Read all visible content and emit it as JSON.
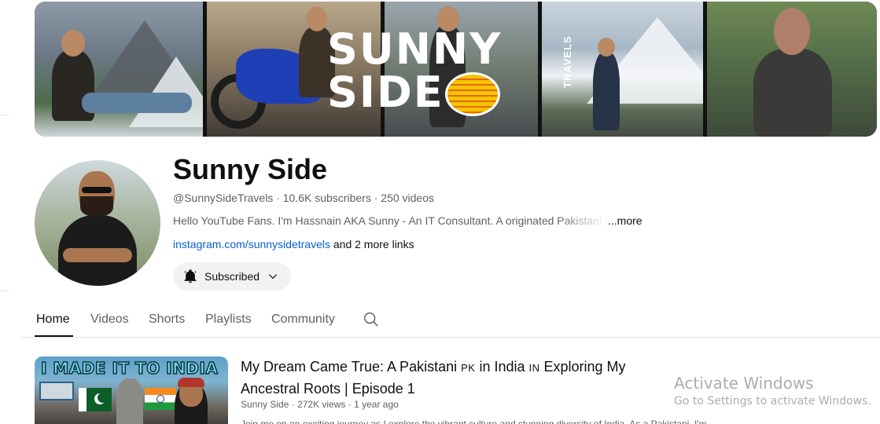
{
  "banner": {
    "logo_line1": "SUNNY",
    "logo_line2": "SIDE",
    "logo_side": "TRAVELS"
  },
  "channel": {
    "name": "Sunny Side",
    "handle": "@SunnySideTravels",
    "subscribers": "10.6K subscribers",
    "videos": "250 videos",
    "separator": " · ",
    "description": "Hello YouTube Fans. I'm Hassnain AKA Sunny - An IT Consultant. A originated Pakistani M",
    "more_label": "...more",
    "link": "instagram.com/sunnysidetravels",
    "more_links": " and 2 more links",
    "subscribe_label": "Subscribed"
  },
  "tabs": [
    {
      "label": "Home",
      "active": true
    },
    {
      "label": "Videos",
      "active": false
    },
    {
      "label": "Shorts",
      "active": false
    },
    {
      "label": "Playlists",
      "active": false
    },
    {
      "label": "Community",
      "active": false
    }
  ],
  "featured_video": {
    "thumbnail_text": "I MADE IT TO INDIA",
    "title_part1": "My Dream Came True: A Pakistani ",
    "flag_pk": "PK",
    "title_part2": " in India ",
    "flag_in": "IN",
    "title_part3": " Exploring My Ancestral Roots | Episode 1",
    "channel": "Sunny Side",
    "views": "272K views",
    "age": "1 year ago",
    "description": "Join me on an exciting journey as I explore the vibrant culture and stunning diversity of India. As a Pakistani, I'm"
  },
  "windows_watermark": {
    "title": "Activate Windows",
    "subtitle": "Go to Settings to activate Windows."
  },
  "icons": {
    "bell": "bell-icon",
    "chevron": "chevron-down-icon",
    "search": "search-icon"
  },
  "colors": {
    "link": "#065fd4",
    "muted_text": "#606060",
    "button_bg": "#f2f2f2"
  }
}
